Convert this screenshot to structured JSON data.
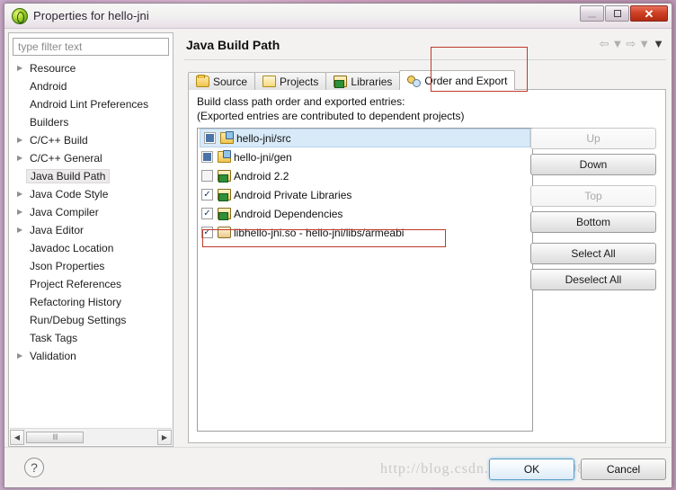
{
  "window": {
    "title": "Properties for hello-jni",
    "app_icon": "eclipse-icon",
    "controls": {
      "minimize": "minimize-icon",
      "maximize": "maximize-icon",
      "close": "✕"
    }
  },
  "sidebar": {
    "filter_placeholder": "type filter text",
    "filter_value": "",
    "items": [
      {
        "label": "Resource",
        "expandable": true,
        "selected": false
      },
      {
        "label": "Android",
        "expandable": false,
        "selected": false
      },
      {
        "label": "Android Lint Preferences",
        "expandable": false,
        "selected": false
      },
      {
        "label": "Builders",
        "expandable": false,
        "selected": false
      },
      {
        "label": "C/C++ Build",
        "expandable": true,
        "selected": false
      },
      {
        "label": "C/C++ General",
        "expandable": true,
        "selected": false
      },
      {
        "label": "Java Build Path",
        "expandable": false,
        "selected": true
      },
      {
        "label": "Java Code Style",
        "expandable": true,
        "selected": false
      },
      {
        "label": "Java Compiler",
        "expandable": true,
        "selected": false
      },
      {
        "label": "Java Editor",
        "expandable": true,
        "selected": false
      },
      {
        "label": "Javadoc Location",
        "expandable": false,
        "selected": false
      },
      {
        "label": "Json Properties",
        "expandable": false,
        "selected": false
      },
      {
        "label": "Project References",
        "expandable": false,
        "selected": false
      },
      {
        "label": "Refactoring History",
        "expandable": false,
        "selected": false
      },
      {
        "label": "Run/Debug Settings",
        "expandable": false,
        "selected": false
      },
      {
        "label": "Task Tags",
        "expandable": false,
        "selected": false
      },
      {
        "label": "Validation",
        "expandable": true,
        "selected": false
      }
    ],
    "scroll_left_arrow": "◀",
    "scroll_right_arrow": "▶",
    "scroll_grip": "‖‖"
  },
  "page": {
    "title": "Java Build Path",
    "nav": {
      "back": "⇦",
      "back_menu": "▼",
      "forward": "⇨",
      "forward_menu": "▼",
      "view_menu": "▼"
    }
  },
  "tabs": [
    {
      "label": "Source",
      "icon": "source-folder-icon",
      "active": false
    },
    {
      "label": "Projects",
      "icon": "projects-folder-icon",
      "active": false
    },
    {
      "label": "Libraries",
      "icon": "libraries-jar-icon",
      "active": false
    },
    {
      "label": "Order and Export",
      "icon": "order-export-icon",
      "active": true
    }
  ],
  "tab_panel": {
    "description_line1": "Build class path order and exported entries:",
    "description_line2": "(Exported entries are contributed to dependent projects)",
    "entries": [
      {
        "label": "hello-jni/src",
        "checkbox": "grayed",
        "icon": "source-folder-icon",
        "selected": true
      },
      {
        "label": "hello-jni/gen",
        "checkbox": "grayed",
        "icon": "source-folder-icon",
        "selected": false
      },
      {
        "label": "Android 2.2",
        "checkbox": "empty",
        "icon": "library-icon",
        "selected": false
      },
      {
        "label": "Android Private Libraries",
        "checkbox": "checked",
        "icon": "library-icon",
        "selected": false
      },
      {
        "label": "Android Dependencies",
        "checkbox": "checked",
        "icon": "library-icon",
        "selected": false
      },
      {
        "label": "libhello-jni.so - hello-jni/libs/armeabi",
        "checkbox": "checked",
        "icon": "native-lib-icon",
        "selected": false
      }
    ],
    "check_glyph": "✓",
    "buttons": [
      {
        "label": "Up",
        "disabled": true,
        "gap": false
      },
      {
        "label": "Down",
        "disabled": false,
        "gap": false
      },
      {
        "label": "Top",
        "disabled": true,
        "gap": true
      },
      {
        "label": "Bottom",
        "disabled": false,
        "gap": false
      },
      {
        "label": "Select All",
        "disabled": false,
        "gap": true
      },
      {
        "label": "Deselect All",
        "disabled": false,
        "gap": false
      }
    ]
  },
  "footer": {
    "help_label": "?",
    "watermark": "http://blog.csdn.net/slmeng1982",
    "ok_label": "OK",
    "cancel_label": "Cancel"
  },
  "annotations": {
    "highlight_color": "#c0392b",
    "boxes": [
      {
        "name": "order-and-export-tab-highlight"
      },
      {
        "name": "native-library-entry-highlight"
      }
    ]
  }
}
